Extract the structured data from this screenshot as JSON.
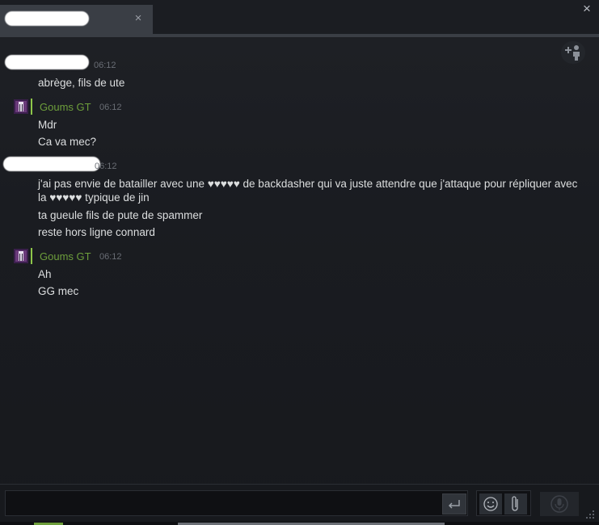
{
  "window": {
    "tab_name": "",
    "tab_close": "×",
    "close": "×"
  },
  "messages": {
    "group1": {
      "sender": "",
      "time": "06:12",
      "lines": [
        "abrège, fils de ute"
      ]
    },
    "group2": {
      "sender": "Goums GT",
      "time": "06:12",
      "lines": [
        "Mdr",
        "Ca va mec?"
      ]
    },
    "group3": {
      "sender": "",
      "time": "06:12",
      "lines": [
        "j'ai pas envie de batailler avec une ♥♥♥♥♥ de backdasher qui va juste attendre que j'attaque pour répliquer avec la ♥♥♥♥♥ typique de jin",
        "ta gueule fils de pute de spammer",
        "reste hors ligne connard"
      ]
    },
    "group4": {
      "sender": "Goums GT",
      "time": "06:12",
      "lines": [
        "Ah",
        "GG mec"
      ]
    }
  },
  "composer": {
    "input_value": ""
  },
  "icons": {
    "send": "enter-icon",
    "emoji": "smiley-icon",
    "attach": "paperclip-icon",
    "voice": "microphone-icon",
    "add_friend": "add-friend-icon"
  },
  "colors": {
    "sender_name": "#6d9e3b",
    "text": "#dcdedf",
    "timestamp": "#6a6e75",
    "avatar_border": "#8ec64a"
  }
}
